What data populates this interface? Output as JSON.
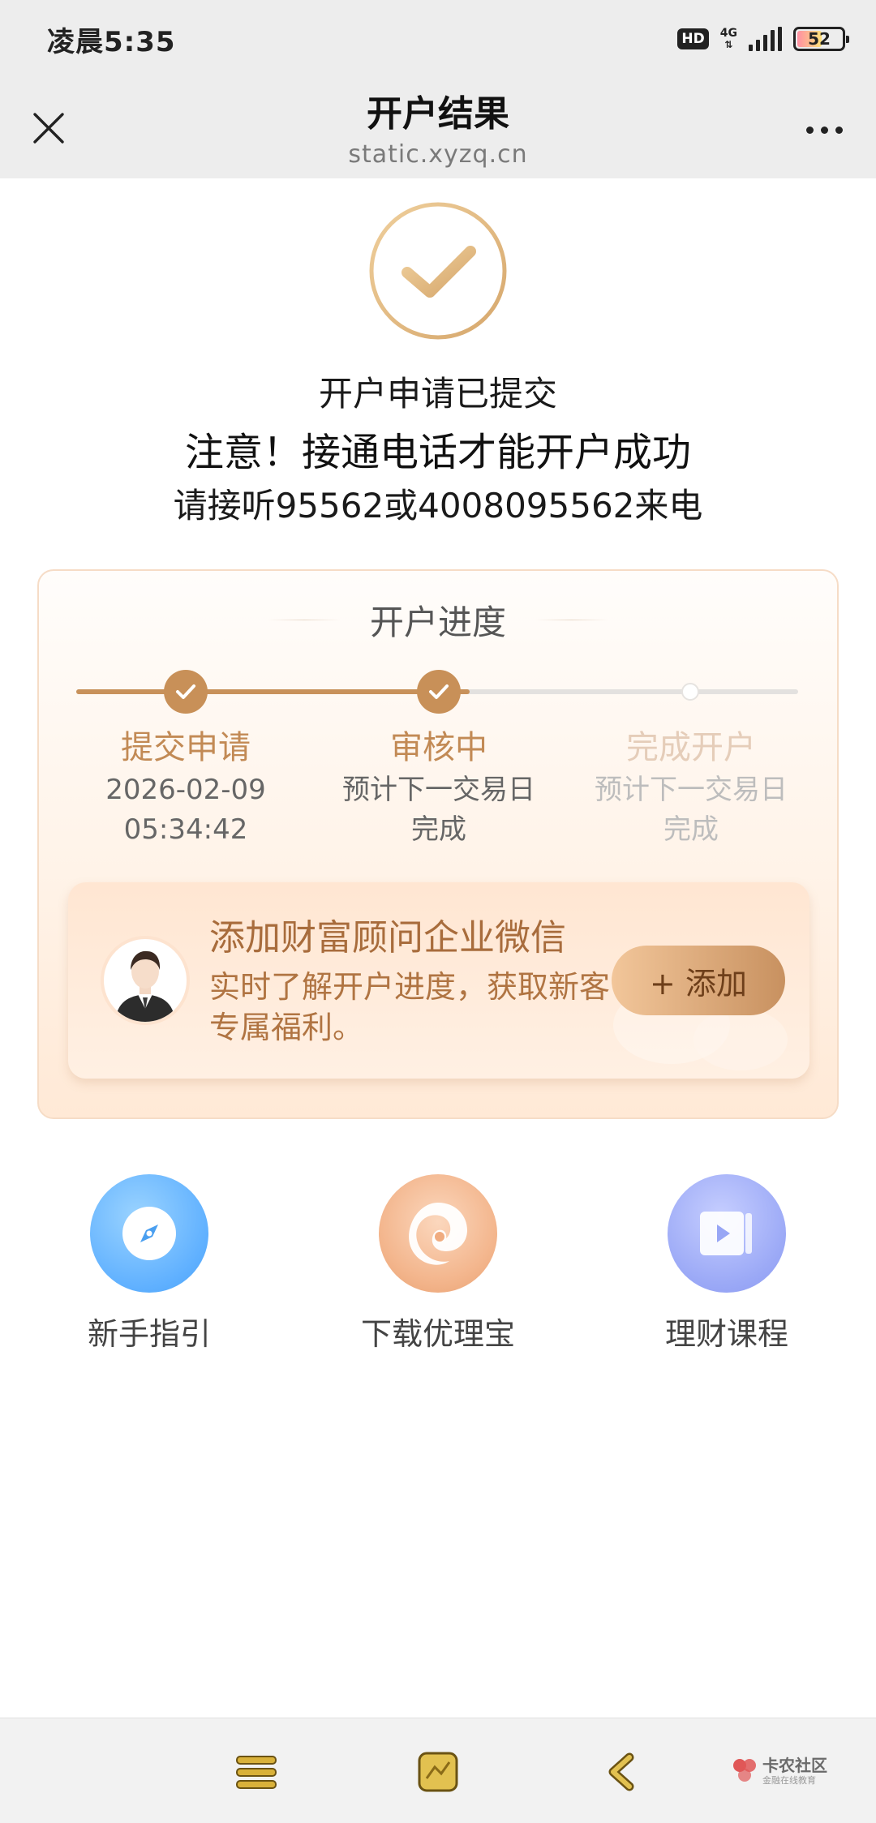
{
  "status_bar": {
    "time": "凌晨5:35",
    "hd_label": "HD",
    "network_label": "4G",
    "battery_level": "52"
  },
  "nav": {
    "title": "开户结果",
    "subtitle": "static.xyzq.cn"
  },
  "result": {
    "line1": "开户申请已提交",
    "line2": "注意！接通电话才能开户成功",
    "line3": "请接听95562或4008095562来电"
  },
  "progress": {
    "title": "开户进度",
    "steps": [
      {
        "name": "提交申请",
        "line1": "2026-02-09",
        "line2": "05:34:42",
        "state": "done"
      },
      {
        "name": "审核中",
        "line1": "预计下一交易日",
        "line2": "完成",
        "state": "done"
      },
      {
        "name": "完成开户",
        "line1": "预计下一交易日",
        "line2": "完成",
        "state": "pending"
      }
    ]
  },
  "wechat": {
    "title": "添加财富顾问企业微信",
    "desc": "实时了解开户进度，获取新客专属福利。",
    "button": "+ 添加"
  },
  "quick_links": [
    {
      "label": "新手指引",
      "icon": "compass-icon"
    },
    {
      "label": "下载优理宝",
      "icon": "app-logo-icon"
    },
    {
      "label": "理财课程",
      "icon": "video-course-icon"
    }
  ],
  "watermark": {
    "name": "卡农社区",
    "sub": "金融在线教育"
  },
  "colors": {
    "accent_gold": "#c89058",
    "bar_bg": "#ededed",
    "card_bg": "#fff3e8"
  }
}
